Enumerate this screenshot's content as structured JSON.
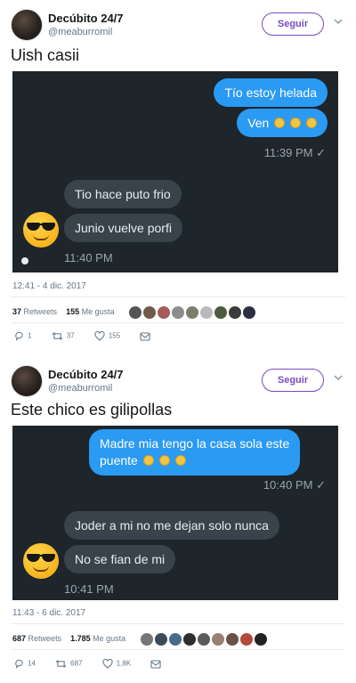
{
  "tweets": [
    {
      "author": {
        "name": "Decúbito 24/7",
        "handle": "@meaburromil"
      },
      "follow_label": "Seguir",
      "text": "Uish casii",
      "chat": {
        "out_1": "Tío estoy helada",
        "out_2": "Ven",
        "out_time": "11:39 PM",
        "in_1": "Tio hace puto frio",
        "in_2": "Junio vuelve porfi",
        "in_time": "11:40 PM"
      },
      "timestamp": "12:41 - 4 dic. 2017",
      "retweets_count": "37",
      "retweets_label": "Retweets",
      "likes_count": "155",
      "likes_label": "Me gusta",
      "actions": {
        "replies": "1",
        "retweets": "37",
        "likes": "155"
      }
    },
    {
      "author": {
        "name": "Decúbito 24/7",
        "handle": "@meaburromil"
      },
      "follow_label": "Seguir",
      "text": "Este chico es gilipollas",
      "chat": {
        "out_1a": "Madre mia tengo la casa sola este",
        "out_1b": "puente",
        "out_time": "10:40 PM",
        "in_1": "Joder a mi no me dejan solo nunca",
        "in_2": "No se fian de mi",
        "in_time": "10:41 PM"
      },
      "timestamp": "11:43 - 6 dic. 2017",
      "retweets_count": "687",
      "retweets_label": "Retweets",
      "likes_count": "1.785",
      "likes_label": "Me gusta",
      "actions": {
        "replies": "14",
        "retweets": "687",
        "likes": "1,8K"
      }
    }
  ],
  "check_mark": "✓",
  "colors": {
    "follow_purple": "#794bc4",
    "bubble_blue": "#2a9af3",
    "chat_bg": "#1e252b"
  },
  "icons": [
    "chevron-down-icon",
    "reply-icon",
    "retweet-icon",
    "like-icon",
    "dm-icon",
    "sunglasses-emoji-icon",
    "relieved-emoji-icon"
  ]
}
